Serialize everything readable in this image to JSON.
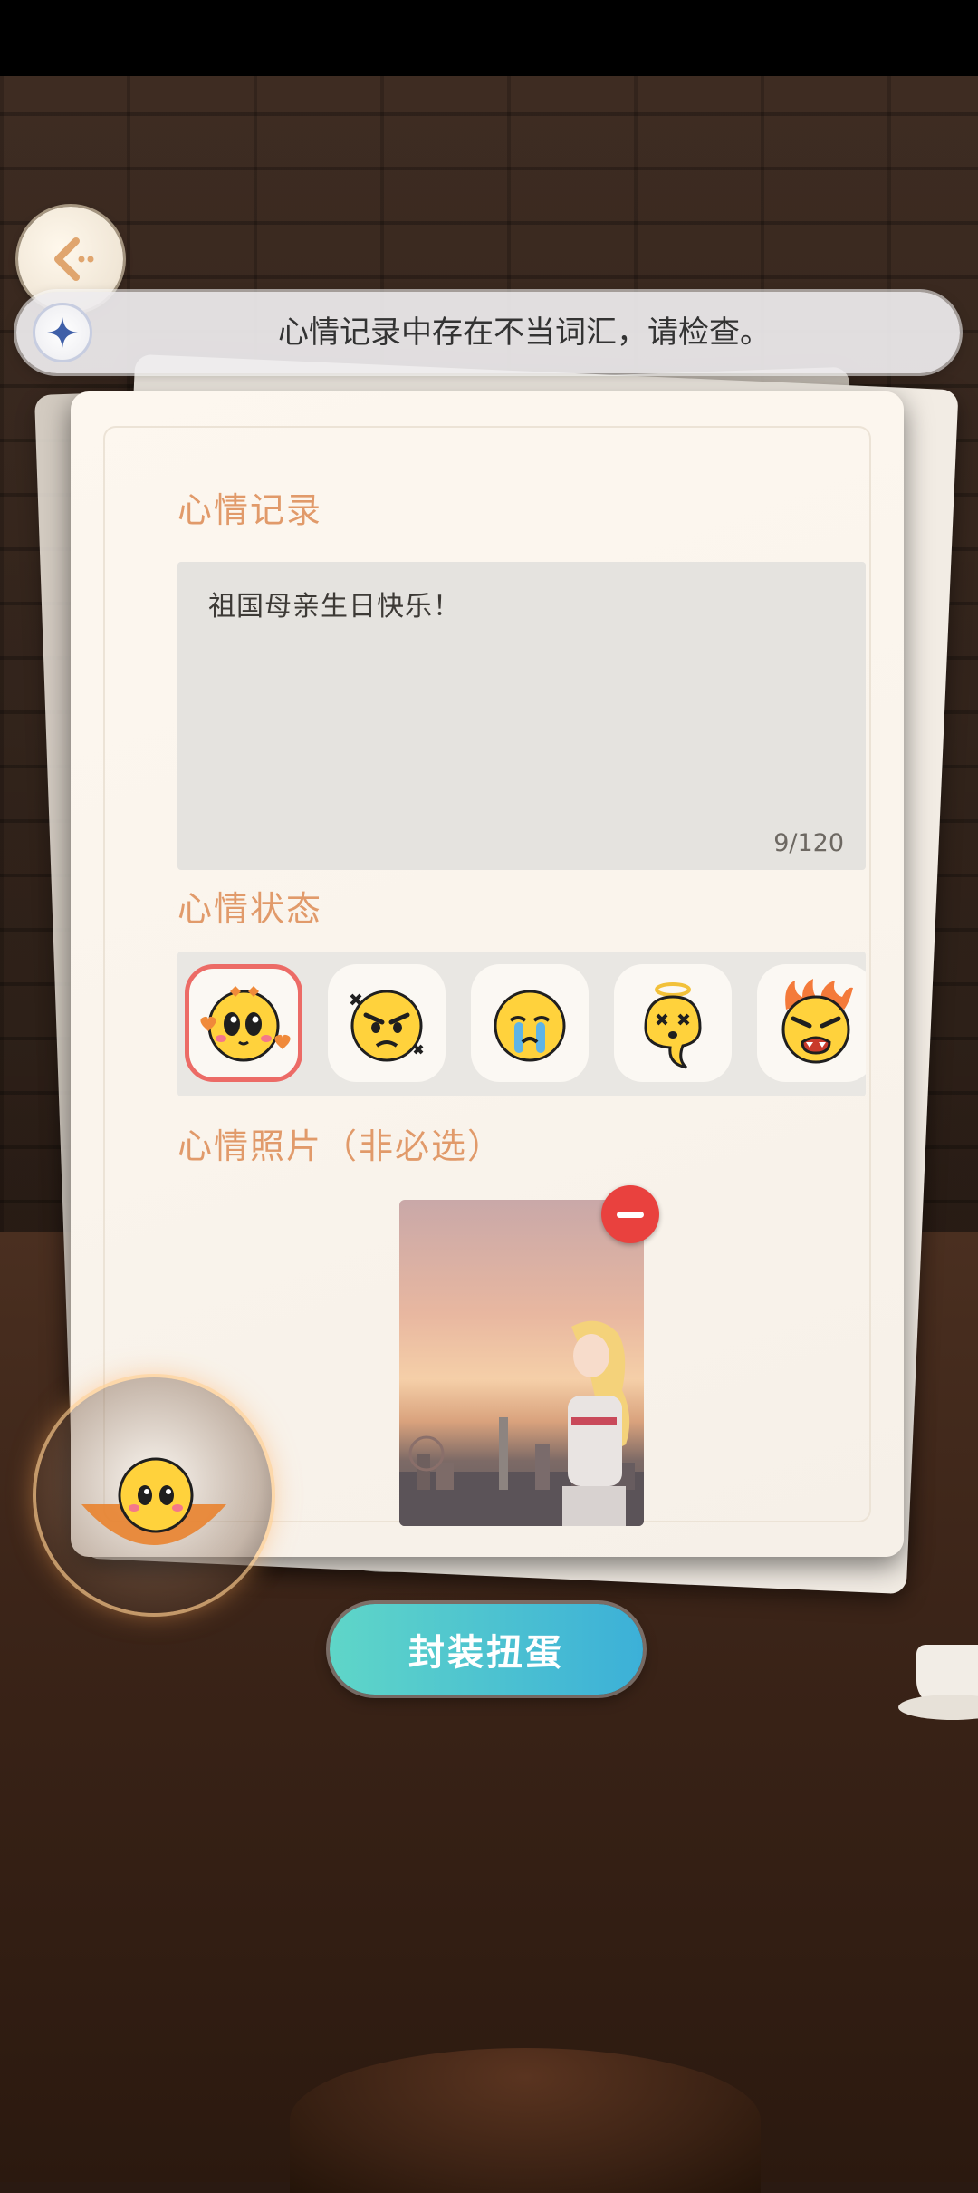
{
  "toast": {
    "message": "心情记录中存在不当词汇，请检查。",
    "icon": "sparkle-icon"
  },
  "back": {
    "icon": "chevron-left-icon"
  },
  "form": {
    "record_title": "心情记录",
    "record_text": "祖国母亲生日快乐！",
    "char_counter": "9/120",
    "mood_title": "心情状态",
    "moods": [
      {
        "name": "love-emoji",
        "selected": true
      },
      {
        "name": "angry-emoji",
        "selected": false
      },
      {
        "name": "crying-emoji",
        "selected": false
      },
      {
        "name": "dizzy-ghost-emoji",
        "selected": false
      },
      {
        "name": "furious-emoji",
        "selected": false
      }
    ],
    "photo_title": "心情照片（非必选）"
  },
  "actions": {
    "seal_label": "封装扭蛋"
  },
  "colors": {
    "accent": "#e19a6a",
    "selected_border": "#ec6b66",
    "remove": "#e9413e",
    "button_start": "#5fd6c8",
    "button_end": "#3cb0d8"
  }
}
